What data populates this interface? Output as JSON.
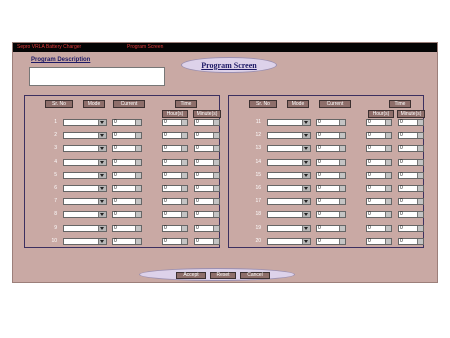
{
  "titlebar": {
    "app_title": "Sepro VRLA Battery Charger",
    "screen_title": "Program Screen"
  },
  "description": {
    "label": "Program Description",
    "value": ""
  },
  "page_heading": "Program Screen",
  "headers": {
    "sr_no": "Sr. No",
    "mode": "Mode",
    "current": "Current",
    "time": "Time",
    "hours": "Hour(s)",
    "minutes": "Minute(s)"
  },
  "left_rows": [
    {
      "n": "1",
      "cur": "0",
      "hr": "0",
      "min": "0"
    },
    {
      "n": "2",
      "cur": "0",
      "hr": "0",
      "min": "0"
    },
    {
      "n": "3",
      "cur": "0",
      "hr": "0",
      "min": "0"
    },
    {
      "n": "4",
      "cur": "0",
      "hr": "0",
      "min": "0"
    },
    {
      "n": "5",
      "cur": "0",
      "hr": "0",
      "min": "0"
    },
    {
      "n": "6",
      "cur": "0",
      "hr": "0",
      "min": "0"
    },
    {
      "n": "7",
      "cur": "0",
      "hr": "0",
      "min": "0"
    },
    {
      "n": "8",
      "cur": "0",
      "hr": "0",
      "min": "0"
    },
    {
      "n": "9",
      "cur": "0",
      "hr": "0",
      "min": "0"
    },
    {
      "n": "10",
      "cur": "0",
      "hr": "0",
      "min": "0"
    }
  ],
  "right_rows": [
    {
      "n": "11",
      "cur": "0",
      "hr": "0",
      "min": "0"
    },
    {
      "n": "12",
      "cur": "0",
      "hr": "0",
      "min": "0"
    },
    {
      "n": "13",
      "cur": "0",
      "hr": "0",
      "min": "0"
    },
    {
      "n": "14",
      "cur": "0",
      "hr": "0",
      "min": "0"
    },
    {
      "n": "15",
      "cur": "0",
      "hr": "0",
      "min": "0"
    },
    {
      "n": "16",
      "cur": "0",
      "hr": "0",
      "min": "0"
    },
    {
      "n": "17",
      "cur": "0",
      "hr": "0",
      "min": "0"
    },
    {
      "n": "18",
      "cur": "0",
      "hr": "0",
      "min": "0"
    },
    {
      "n": "19",
      "cur": "0",
      "hr": "0",
      "min": "0"
    },
    {
      "n": "20",
      "cur": "0",
      "hr": "0",
      "min": "0"
    }
  ],
  "buttons": {
    "accept": "Accept",
    "reset": "Reset",
    "cancel": "Cancel"
  }
}
